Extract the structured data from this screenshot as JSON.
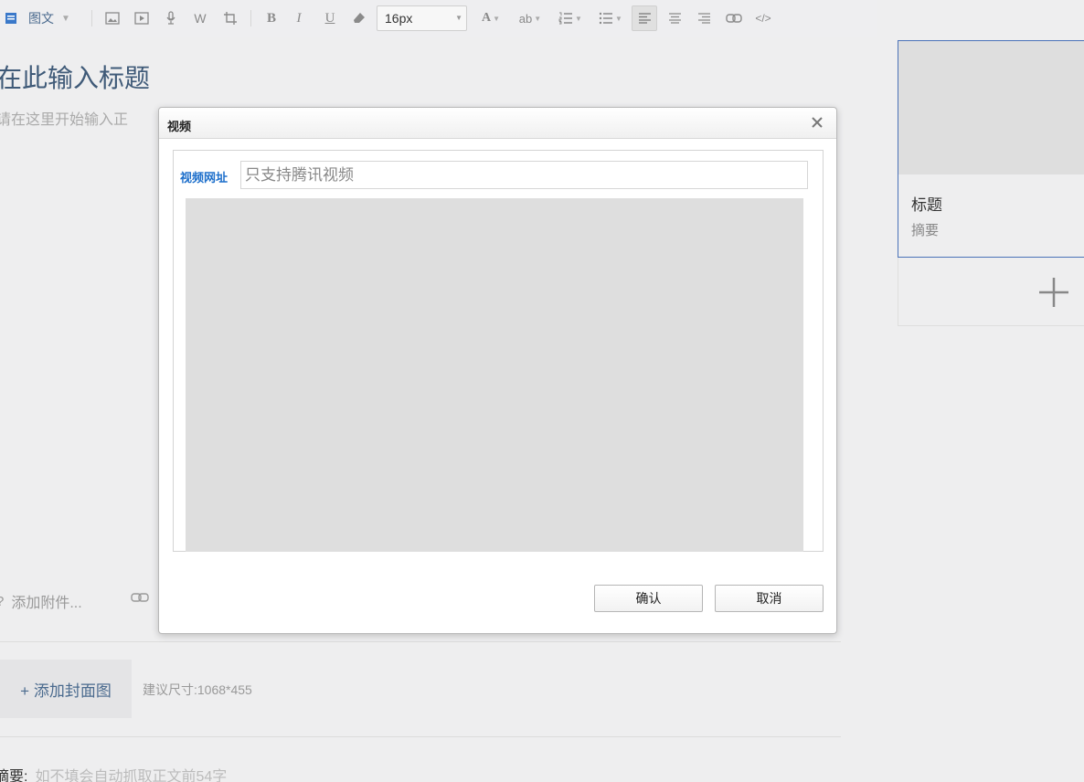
{
  "toolbar": {
    "mode_label": "图文",
    "font_size": "16px",
    "icons": [
      "image-icon",
      "video-icon",
      "audio-icon",
      "word-icon",
      "crop-icon",
      "bold-icon",
      "italic-icon",
      "underline-icon",
      "eraser-icon",
      "font-color-icon",
      "highlight-icon",
      "ordered-list-icon",
      "unordered-list-icon",
      "align-left-icon",
      "align-center-icon",
      "align-right-icon",
      "link-icon",
      "code-icon"
    ]
  },
  "editor": {
    "title_placeholder": "在此输入标题",
    "body_placeholder": "请在这里开始输入正",
    "attach_label": "添加附件...",
    "cover_button": "+ 添加封面图",
    "cover_hint": "建议尺寸:1068*455",
    "summary_label": "摘要:",
    "summary_placeholder": "如不填会自动抓取正文前54字"
  },
  "card": {
    "title": "标题",
    "summary": "摘要"
  },
  "dialog": {
    "title": "视频",
    "url_label": "视频网址",
    "url_placeholder": "只支持腾讯视频",
    "confirm_label": "确认",
    "cancel_label": "取消"
  },
  "colors": {
    "accent_blue": "#1d6fcb",
    "card_border": "#4a72b8",
    "title_color": "#3f5a78",
    "preview_bg": "#dedede"
  }
}
